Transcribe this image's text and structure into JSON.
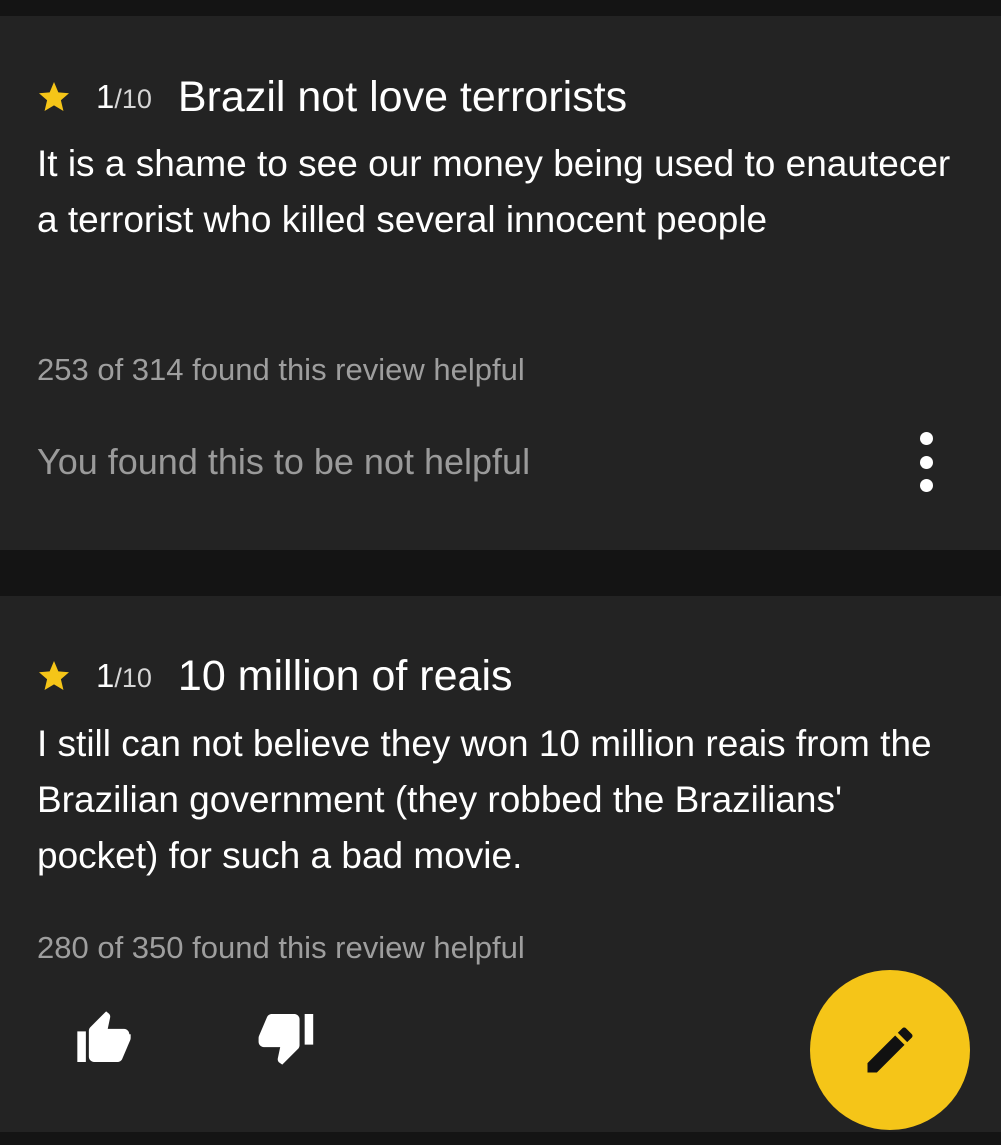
{
  "reviews": [
    {
      "score": "1",
      "score_max": "/10",
      "title": "Brazil not love terrorists",
      "body": "It is a shame to see our money being used to enautecer a terrorist who killed several innocent people",
      "helpful_text": "253 of 314 found this review helpful",
      "vote_status": "You found this to be not helpful"
    },
    {
      "score": "1",
      "score_max": "/10",
      "title": "10 million of reais",
      "body": "I still can not believe they won 10 million reais from the Brazilian government (they robbed the Brazilians' pocket) for such a bad movie.",
      "helpful_text": "280 of 350 found this review helpful"
    }
  ],
  "icons": {
    "star": "star-icon",
    "more": "more-vert-icon",
    "thumbs_up": "thumbs-up-icon",
    "thumbs_down": "thumbs-down-icon",
    "edit": "pencil-icon"
  },
  "colors": {
    "star": "#f5c518",
    "fab": "#f5c518",
    "card_bg": "#232323",
    "page_bg": "#141414"
  }
}
